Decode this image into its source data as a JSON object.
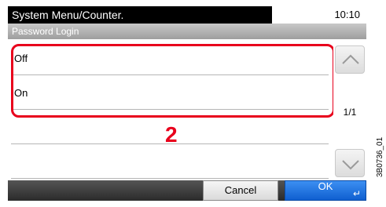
{
  "header": {
    "title": "System Menu/Counter.",
    "time": "10:10"
  },
  "screen_title": "Password Login",
  "options": [
    {
      "label": "Off"
    },
    {
      "label": "On"
    },
    {
      "label": ""
    },
    {
      "label": ""
    }
  ],
  "callout_number": "2",
  "pagination": {
    "text": "1/1"
  },
  "buttons": {
    "cancel_label": "Cancel",
    "ok_label": "OK"
  },
  "figure_id": "3B0736_01",
  "colors": {
    "highlight": "#e8001c",
    "ok_button": "#1f6fe0",
    "title_bar": "#000000"
  }
}
